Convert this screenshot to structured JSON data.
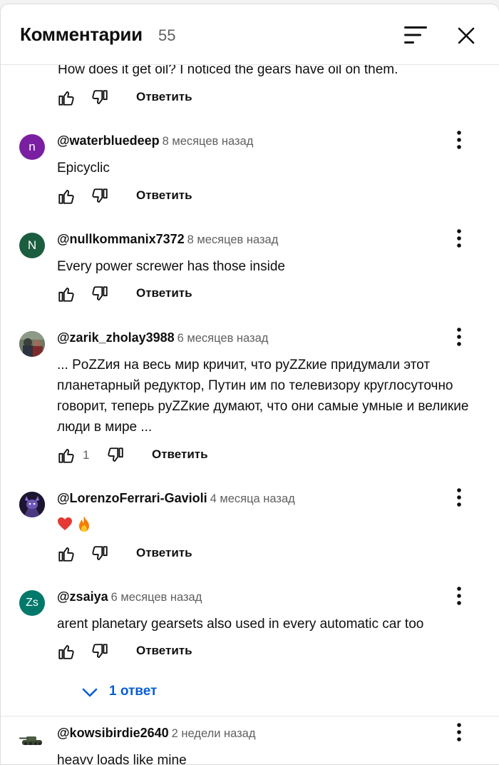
{
  "header": {
    "title": "Комментарии",
    "count": "55",
    "sort_icon": "sort-icon",
    "close_icon": "close-icon"
  },
  "cut_comment": {
    "text": "How does it get oil? I noticed the gears have oil on them.",
    "reply_label": "Ответить"
  },
  "comments": [
    {
      "avatar_letter": "n",
      "avatar_color": "#7b1fa2",
      "handle": "@waterbluedeep",
      "time": "8 месяцев назад",
      "text": "Epicyclic",
      "likes": "",
      "reply_label": "Ответить"
    },
    {
      "avatar_letter": "N",
      "avatar_color": "#1b5e3f",
      "handle": "@nullkommanix7372",
      "time": "8 месяцев назад",
      "text": "Every power screwer has those inside",
      "likes": "",
      "reply_label": "Ответить"
    },
    {
      "avatar_letter": "",
      "avatar_color": "#5a5f55",
      "handle": "@zarik_zholay3988",
      "time": "6 месяцев назад",
      "text": "... PoZZия на весь мир кричит, что руZZкие придумали этот планетарный редуктор, Путин им по телевизору круглосуточно говорит, теперь руZZкие думают, что они самые умные и великие люди в мире ...",
      "likes": "1",
      "reply_label": "Ответить"
    },
    {
      "avatar_letter": "",
      "avatar_color": "#2a2140",
      "handle": "@LorenzoFerrari-Gavioli",
      "time": "4 месяца назад",
      "text": "",
      "emojis": [
        "heart-emoji",
        "fire-emoji"
      ],
      "likes": "",
      "reply_label": "Ответить"
    },
    {
      "avatar_letter": "Zs",
      "avatar_color": "#00796b",
      "handle": "@zsaiya",
      "time": "6 месяцев назад",
      "text": "arent planetary gearsets also used in every automatic car too",
      "likes": "",
      "reply_label": "Ответить",
      "replies_label": "1 ответ"
    },
    {
      "avatar_letter": "",
      "avatar_color": "#ffffff",
      "handle": "@kowsibirdie2640",
      "time": "2 недели назад",
      "text": "heavy loads like mine"
    }
  ],
  "colors": {
    "link_blue": "#065fd4",
    "secondary_text": "#606060"
  }
}
